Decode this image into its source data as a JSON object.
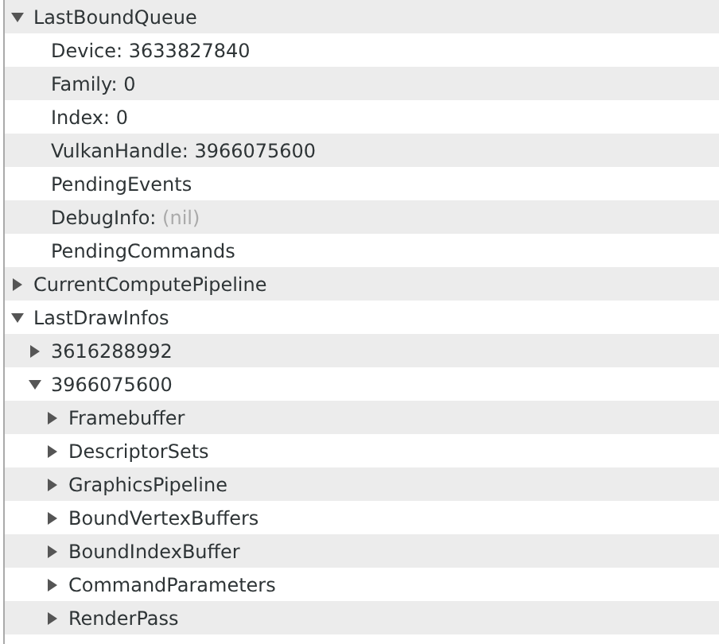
{
  "tree": [
    {
      "label": "LastBoundQueue",
      "expanded": true,
      "children": [
        {
          "label": "Device:",
          "value": "3633827840",
          "muted": false
        },
        {
          "label": "Family:",
          "value": "0",
          "muted": false
        },
        {
          "label": "Index:",
          "value": "0",
          "muted": false
        },
        {
          "label": "VulkanHandle:",
          "value": "3966075600",
          "muted": false
        },
        {
          "label": "PendingEvents"
        },
        {
          "label": "DebugInfo:",
          "value": "(nil)",
          "muted": true
        },
        {
          "label": "PendingCommands"
        }
      ]
    },
    {
      "label": "CurrentComputePipeline",
      "expanded": false
    },
    {
      "label": "LastDrawInfos",
      "expanded": true,
      "children": [
        {
          "label": "3616288992",
          "expanded": false
        },
        {
          "label": "3966075600",
          "expanded": true,
          "children": [
            {
              "label": "Framebuffer",
              "expanded": false
            },
            {
              "label": "DescriptorSets",
              "expanded": false
            },
            {
              "label": "GraphicsPipeline",
              "expanded": false
            },
            {
              "label": "BoundVertexBuffers",
              "expanded": false
            },
            {
              "label": "BoundIndexBuffer",
              "expanded": false
            },
            {
              "label": "CommandParameters",
              "expanded": false
            },
            {
              "label": "RenderPass",
              "expanded": false
            }
          ]
        }
      ]
    }
  ]
}
